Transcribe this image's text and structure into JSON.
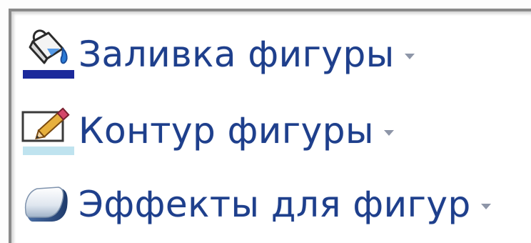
{
  "ribbon": {
    "items": [
      {
        "label": "Заливка фигуры",
        "icon": "paint-bucket-icon"
      },
      {
        "label": "Контур фигуры",
        "icon": "pencil-outline-icon"
      },
      {
        "label": "Эффекты для фигур",
        "icon": "shape-effects-icon"
      }
    ]
  },
  "colors": {
    "label_text": "#1e3f8c",
    "fill_bar": "#1c2a9b",
    "outline_bar": "#bfe3ef",
    "dropdown_arrow": "#8e96a8"
  }
}
